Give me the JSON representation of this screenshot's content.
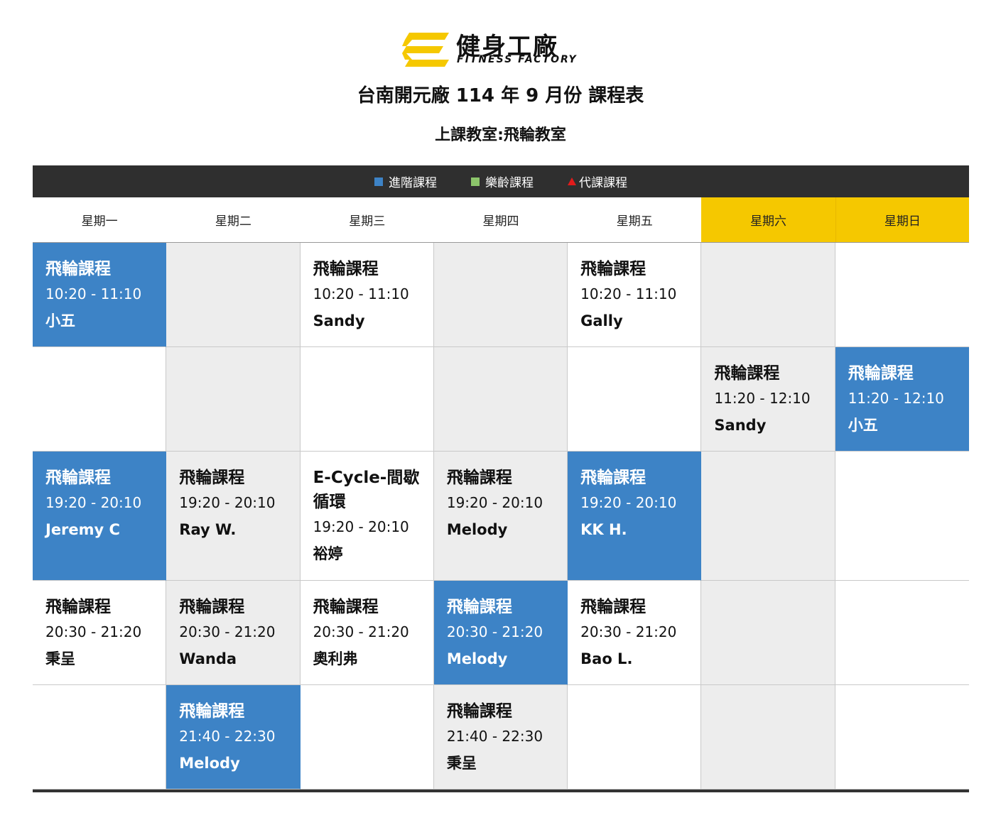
{
  "brand": {
    "name_cn": "健身工廠",
    "name_en": "FITNESS FACTORY",
    "accent_color": "#f5c800"
  },
  "title": "台南開元廠 114 年 9 月份 課程表",
  "subtitle": "上課教室:飛輪教室",
  "legend": [
    {
      "label": "進階課程",
      "color": "#3d83c6",
      "shape": "square"
    },
    {
      "label": "樂齡課程",
      "color": "#8cc56b",
      "shape": "square"
    },
    {
      "label": "代課課程",
      "color": "#e21b1b",
      "shape": "triangle"
    }
  ],
  "days": [
    "星期一",
    "星期二",
    "星期三",
    "星期四",
    "星期五",
    "星期六",
    "星期日"
  ],
  "colors": {
    "advanced": "#3d83c6",
    "grey": "#ededed",
    "weekend_header": "#f5c800",
    "legend_bar": "#2f2f2f"
  },
  "rows": [
    [
      {
        "style": "blue",
        "name": "飛輪課程",
        "time": "10:20 - 11:10",
        "teacher": "小五"
      },
      {
        "style": "grey"
      },
      {
        "style": "white",
        "name": "飛輪課程",
        "time": "10:20 - 11:10",
        "teacher": "Sandy"
      },
      {
        "style": "grey"
      },
      {
        "style": "white",
        "name": "飛輪課程",
        "time": "10:20 - 11:10",
        "teacher": "Gally"
      },
      {
        "style": "grey"
      },
      {
        "style": "white"
      }
    ],
    [
      {
        "style": "white"
      },
      {
        "style": "grey"
      },
      {
        "style": "white"
      },
      {
        "style": "grey"
      },
      {
        "style": "white"
      },
      {
        "style": "grey",
        "name": "飛輪課程",
        "time": "11:20 - 12:10",
        "teacher": "Sandy"
      },
      {
        "style": "blue",
        "name": "飛輪課程",
        "time": "11:20 - 12:10",
        "teacher": "小五"
      }
    ],
    [
      {
        "style": "blue",
        "name": "飛輪課程",
        "time": "19:20 - 20:10",
        "teacher": "Jeremy C"
      },
      {
        "style": "grey",
        "name": "飛輪課程",
        "time": "19:20 - 20:10",
        "teacher": "Ray W."
      },
      {
        "style": "white",
        "name": "E-Cycle-間歇循環",
        "time": "19:20 - 20:10",
        "teacher": "裕婷"
      },
      {
        "style": "grey",
        "name": "飛輪課程",
        "time": "19:20 - 20:10",
        "teacher": "Melody"
      },
      {
        "style": "blue",
        "name": "飛輪課程",
        "time": "19:20 - 20:10",
        "teacher": "KK H."
      },
      {
        "style": "grey"
      },
      {
        "style": "white"
      }
    ],
    [
      {
        "style": "white",
        "name": "飛輪課程",
        "time": "20:30 - 21:20",
        "teacher": "秉呈"
      },
      {
        "style": "grey",
        "name": "飛輪課程",
        "time": "20:30 - 21:20",
        "teacher": "Wanda"
      },
      {
        "style": "white",
        "name": "飛輪課程",
        "time": "20:30 - 21:20",
        "teacher": "奧利弗"
      },
      {
        "style": "blue",
        "name": "飛輪課程",
        "time": "20:30 - 21:20",
        "teacher": "Melody"
      },
      {
        "style": "white",
        "name": "飛輪課程",
        "time": "20:30 - 21:20",
        "teacher": "Bao L."
      },
      {
        "style": "grey"
      },
      {
        "style": "white"
      }
    ],
    [
      {
        "style": "white"
      },
      {
        "style": "blue",
        "name": "飛輪課程",
        "time": "21:40 - 22:30",
        "teacher": "Melody"
      },
      {
        "style": "white"
      },
      {
        "style": "grey",
        "name": "飛輪課程",
        "time": "21:40 - 22:30",
        "teacher": "秉呈"
      },
      {
        "style": "white"
      },
      {
        "style": "grey"
      },
      {
        "style": "white"
      }
    ]
  ]
}
